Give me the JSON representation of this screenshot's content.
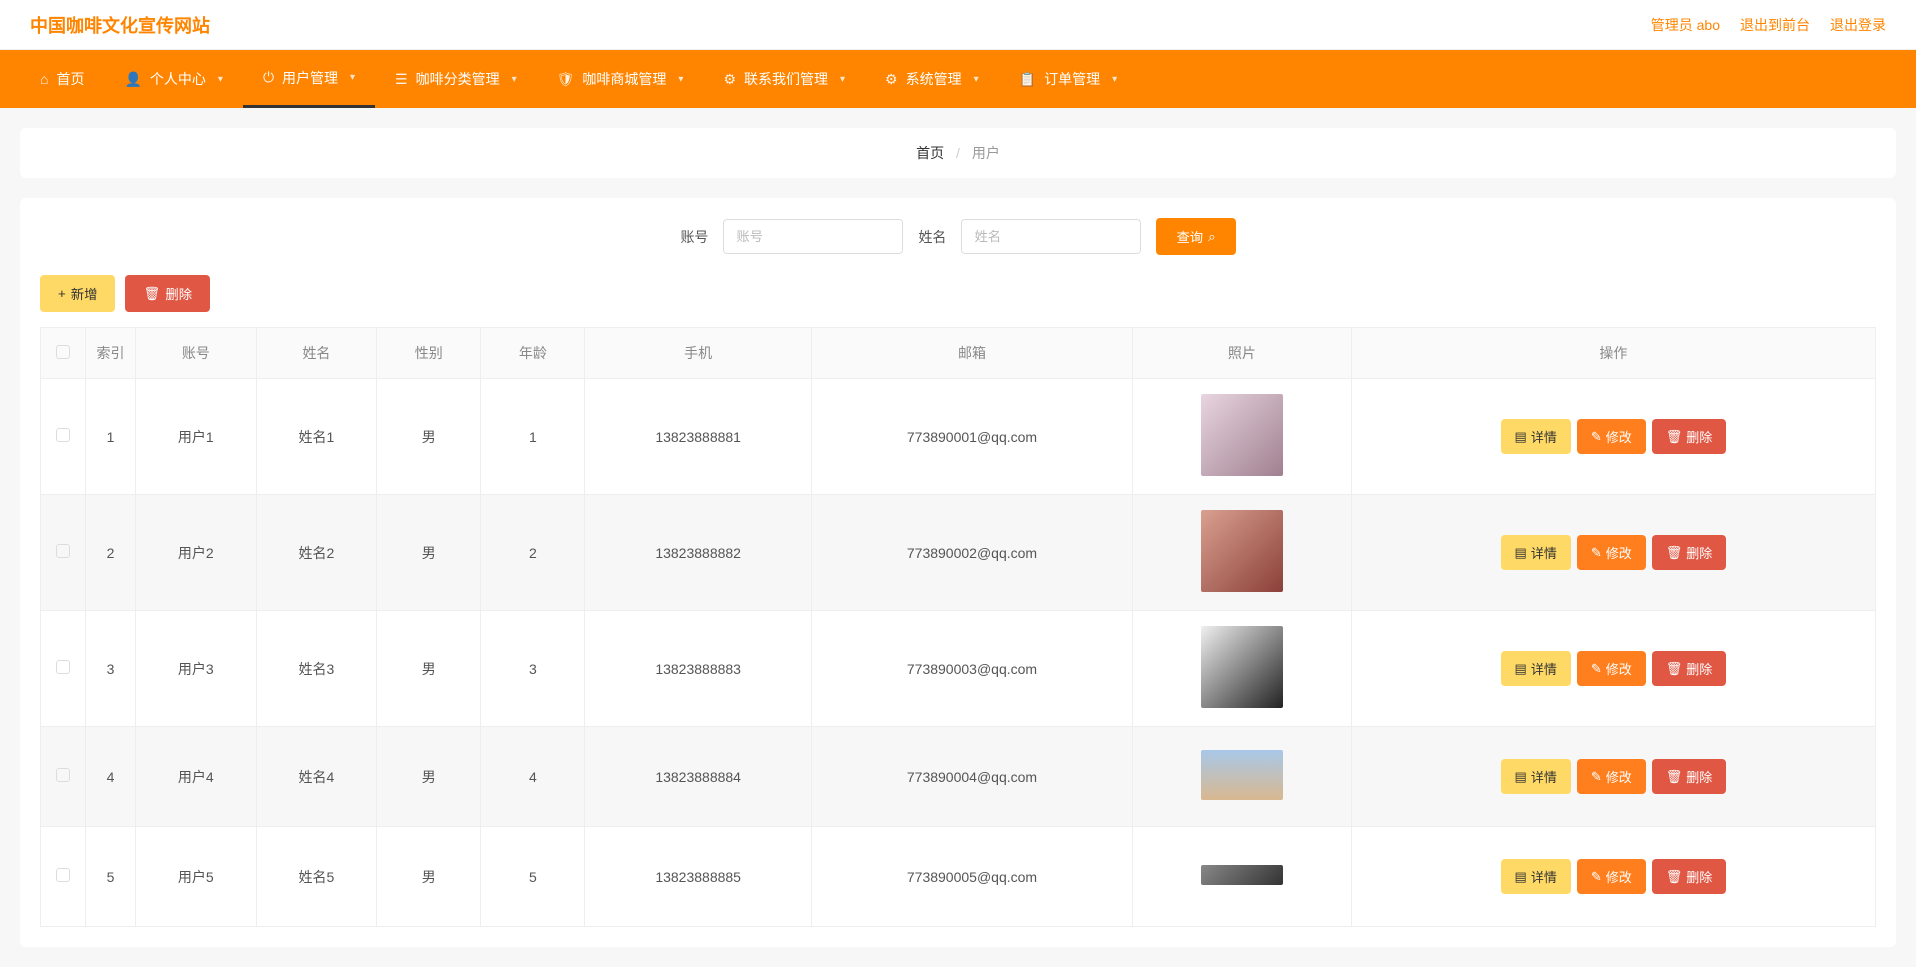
{
  "header": {
    "siteTitle": "中国咖啡文化宣传网站",
    "adminLabel": "管理员 abo",
    "backToFront": "退出到前台",
    "logout": "退出登录"
  },
  "nav": {
    "items": [
      {
        "icon": "⌂",
        "label": "首页",
        "hasCaret": false
      },
      {
        "icon": "👤",
        "label": "个人中心",
        "hasCaret": true
      },
      {
        "icon": "⏻",
        "label": "用户管理",
        "hasCaret": true
      },
      {
        "icon": "☰",
        "label": "咖啡分类管理",
        "hasCaret": true
      },
      {
        "icon": "🛡",
        "label": "咖啡商城管理",
        "hasCaret": true
      },
      {
        "icon": "⚙",
        "label": "联系我们管理",
        "hasCaret": true
      },
      {
        "icon": "⚙",
        "label": "系统管理",
        "hasCaret": true
      },
      {
        "icon": "📋",
        "label": "订单管理",
        "hasCaret": true
      }
    ],
    "activeIndex": 2
  },
  "breadcrumb": {
    "home": "首页",
    "sep": "/",
    "current": "用户"
  },
  "search": {
    "accountLabel": "账号",
    "accountPlaceholder": "账号",
    "nameLabel": "姓名",
    "namePlaceholder": "姓名",
    "searchBtn": "查询"
  },
  "toolbar": {
    "addBtn": "新增",
    "deleteBtn": "删除"
  },
  "table": {
    "headers": {
      "index": "索引",
      "account": "账号",
      "name": "姓名",
      "gender": "性别",
      "age": "年龄",
      "phone": "手机",
      "email": "邮箱",
      "photo": "照片",
      "action": "操作"
    },
    "actionLabels": {
      "detail": "详情",
      "edit": "修改",
      "delete": "删除"
    },
    "rows": [
      {
        "index": "1",
        "account": "用户1",
        "name": "姓名1",
        "gender": "男",
        "age": "1",
        "phone": "13823888881",
        "email": "773890001@qq.com",
        "photoClass": "p1"
      },
      {
        "index": "2",
        "account": "用户2",
        "name": "姓名2",
        "gender": "男",
        "age": "2",
        "phone": "13823888882",
        "email": "773890002@qq.com",
        "photoClass": "p2"
      },
      {
        "index": "3",
        "account": "用户3",
        "name": "姓名3",
        "gender": "男",
        "age": "3",
        "phone": "13823888883",
        "email": "773890003@qq.com",
        "photoClass": "p3"
      },
      {
        "index": "4",
        "account": "用户4",
        "name": "姓名4",
        "gender": "男",
        "age": "4",
        "phone": "13823888884",
        "email": "773890004@qq.com",
        "photoClass": "p4"
      },
      {
        "index": "5",
        "account": "用户5",
        "name": "姓名5",
        "gender": "男",
        "age": "5",
        "phone": "13823888885",
        "email": "773890005@qq.com",
        "photoClass": "p5"
      }
    ]
  }
}
